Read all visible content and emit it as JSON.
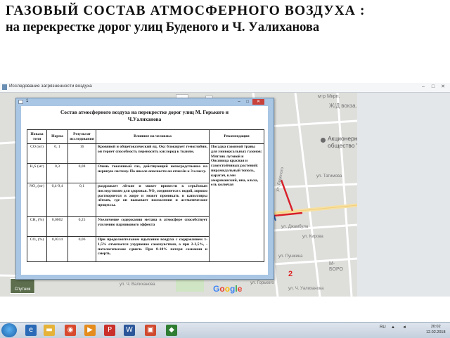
{
  "slide": {
    "title_line1": "ГАЗОВЫЙ СОСТАВ АТМОСФЕРНОГО ВОЗДУХА :",
    "title_line2": "на перекрестке дорог улиц Буденого и Ч. Уалиханова"
  },
  "app_window": {
    "title": "Исследование загрязненности воздуха",
    "buttons": [
      "–",
      "□",
      "✕"
    ]
  },
  "map": {
    "labels": {
      "mzhd": "м-р Мкрн.",
      "zhd_vok": "Ж/Д вокза...",
      "ul_tatimova": "ул. Татимова",
      "ul_dzhambula": "ул. Джамбула",
      "ul_pushkina": "ул. Пушкина",
      "ul_budenogo": "ул. Буденого",
      "ul_kirova": "ул. Кирова",
      "m_boro": "М-\nБОРО",
      "ul_gor": "ул. Горького",
      "ul_val": "ул. Ч. Уалиханова",
      "ul_chokana": "ул. Ч. Валиханова"
    },
    "poi": "Акционерное\nобщество \"Т",
    "marker_number": "2",
    "sputnik": "Спутник",
    "google": [
      "G",
      "o",
      "o",
      "g",
      "l",
      "e"
    ],
    "google_colors": [
      "#4285f4",
      "#ea4335",
      "#fbbc05",
      "#4285f4",
      "#34a853",
      "#ea4335"
    ],
    "zoom": [
      "+",
      "−"
    ]
  },
  "dialog": {
    "title": "1",
    "buttons": [
      "–",
      "□",
      "✕"
    ],
    "doc_title_line1": "Состав атмосферного воздуха на перекрестке дорог улиц М. Горького и",
    "doc_title_line2": "Ч.Уалиханова"
  },
  "table": {
    "headers": [
      "Показа тели",
      "Норма",
      "Результат исследования",
      "Влияние на человека",
      "Рекомендация"
    ],
    "rows": [
      {
        "indicator": "CO (мг)",
        "norm": "0, 1",
        "result": "16",
        "effect": "Кровяной и общетоксический яд. Окс блокирует гемоглобин, он теряет способность переносить кислород к тканям."
      },
      {
        "indicator": "H₂S (мг)",
        "norm": "0,3",
        "result": "0,08",
        "effect": "Очень токсичный газ, действующий непосредственно на нервную систему. По шкале опасности он отнесён к 3 классу."
      },
      {
        "indicator": "NO₂ (мг)",
        "norm": "0,4-9,4",
        "result": "0,1",
        "effect": "раздражает лёгкие и может привести к серьёзным последствиям для здоровья. NO₂ соединяется с водой, хорошо растворяется в жире и может проникать в капилляры лёгких, где он вызывает воспаления и астматические процессы."
      },
      {
        "indicator": "CH₄ (%)",
        "norm": "0,0002",
        "result": "0,25",
        "effect": "Увеличение содержания метана в атмосфере способствует усилению парникового эффекта"
      },
      {
        "indicator": "CO₂ (%)",
        "norm": "0,0314",
        "result": "0,06",
        "effect": "При продолжительном вдыхании воздуха с содержанием 1-1,5% отмечается ухудшение самочувствия, а при 2-2,5%, - патологические сдвиги. При 8-10% потеря сознания и смерть."
      }
    ],
    "recommendation": "Посадка газонной травы для универсальных газонов: Мятлик луговой и Овсяница красная и газоустойчивых растений: пирамидальный тополь, карагач, клен американский, ива, ольха, ель колючая"
  },
  "taskbar": {
    "tray_lang": "RU",
    "tray_up": "▲",
    "tray_sound": "◄",
    "time": "20:02",
    "date": "12.02.2018"
  }
}
